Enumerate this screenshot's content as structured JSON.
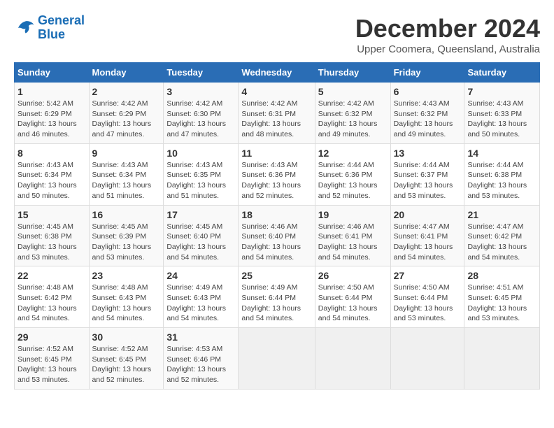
{
  "logo": {
    "line1": "General",
    "line2": "Blue"
  },
  "title": "December 2024",
  "location": "Upper Coomera, Queensland, Australia",
  "days_of_week": [
    "Sunday",
    "Monday",
    "Tuesday",
    "Wednesday",
    "Thursday",
    "Friday",
    "Saturday"
  ],
  "weeks": [
    [
      {
        "day": "1",
        "sunrise": "5:42 AM",
        "sunset": "6:29 PM",
        "daylight": "13 hours and 46 minutes."
      },
      {
        "day": "2",
        "sunrise": "4:42 AM",
        "sunset": "6:29 PM",
        "daylight": "13 hours and 47 minutes."
      },
      {
        "day": "3",
        "sunrise": "4:42 AM",
        "sunset": "6:30 PM",
        "daylight": "13 hours and 47 minutes."
      },
      {
        "day": "4",
        "sunrise": "4:42 AM",
        "sunset": "6:31 PM",
        "daylight": "13 hours and 48 minutes."
      },
      {
        "day": "5",
        "sunrise": "4:42 AM",
        "sunset": "6:32 PM",
        "daylight": "13 hours and 49 minutes."
      },
      {
        "day": "6",
        "sunrise": "4:43 AM",
        "sunset": "6:32 PM",
        "daylight": "13 hours and 49 minutes."
      },
      {
        "day": "7",
        "sunrise": "4:43 AM",
        "sunset": "6:33 PM",
        "daylight": "13 hours and 50 minutes."
      }
    ],
    [
      {
        "day": "8",
        "sunrise": "4:43 AM",
        "sunset": "6:34 PM",
        "daylight": "13 hours and 50 minutes."
      },
      {
        "day": "9",
        "sunrise": "4:43 AM",
        "sunset": "6:34 PM",
        "daylight": "13 hours and 51 minutes."
      },
      {
        "day": "10",
        "sunrise": "4:43 AM",
        "sunset": "6:35 PM",
        "daylight": "13 hours and 51 minutes."
      },
      {
        "day": "11",
        "sunrise": "4:43 AM",
        "sunset": "6:36 PM",
        "daylight": "13 hours and 52 minutes."
      },
      {
        "day": "12",
        "sunrise": "4:44 AM",
        "sunset": "6:36 PM",
        "daylight": "13 hours and 52 minutes."
      },
      {
        "day": "13",
        "sunrise": "4:44 AM",
        "sunset": "6:37 PM",
        "daylight": "13 hours and 53 minutes."
      },
      {
        "day": "14",
        "sunrise": "4:44 AM",
        "sunset": "6:38 PM",
        "daylight": "13 hours and 53 minutes."
      }
    ],
    [
      {
        "day": "15",
        "sunrise": "4:45 AM",
        "sunset": "6:38 PM",
        "daylight": "13 hours and 53 minutes."
      },
      {
        "day": "16",
        "sunrise": "4:45 AM",
        "sunset": "6:39 PM",
        "daylight": "13 hours and 53 minutes."
      },
      {
        "day": "17",
        "sunrise": "4:45 AM",
        "sunset": "6:40 PM",
        "daylight": "13 hours and 54 minutes."
      },
      {
        "day": "18",
        "sunrise": "4:46 AM",
        "sunset": "6:40 PM",
        "daylight": "13 hours and 54 minutes."
      },
      {
        "day": "19",
        "sunrise": "4:46 AM",
        "sunset": "6:41 PM",
        "daylight": "13 hours and 54 minutes."
      },
      {
        "day": "20",
        "sunrise": "4:47 AM",
        "sunset": "6:41 PM",
        "daylight": "13 hours and 54 minutes."
      },
      {
        "day": "21",
        "sunrise": "4:47 AM",
        "sunset": "6:42 PM",
        "daylight": "13 hours and 54 minutes."
      }
    ],
    [
      {
        "day": "22",
        "sunrise": "4:48 AM",
        "sunset": "6:42 PM",
        "daylight": "13 hours and 54 minutes."
      },
      {
        "day": "23",
        "sunrise": "4:48 AM",
        "sunset": "6:43 PM",
        "daylight": "13 hours and 54 minutes."
      },
      {
        "day": "24",
        "sunrise": "4:49 AM",
        "sunset": "6:43 PM",
        "daylight": "13 hours and 54 minutes."
      },
      {
        "day": "25",
        "sunrise": "4:49 AM",
        "sunset": "6:44 PM",
        "daylight": "13 hours and 54 minutes."
      },
      {
        "day": "26",
        "sunrise": "4:50 AM",
        "sunset": "6:44 PM",
        "daylight": "13 hours and 54 minutes."
      },
      {
        "day": "27",
        "sunrise": "4:50 AM",
        "sunset": "6:44 PM",
        "daylight": "13 hours and 53 minutes."
      },
      {
        "day": "28",
        "sunrise": "4:51 AM",
        "sunset": "6:45 PM",
        "daylight": "13 hours and 53 minutes."
      }
    ],
    [
      {
        "day": "29",
        "sunrise": "4:52 AM",
        "sunset": "6:45 PM",
        "daylight": "13 hours and 53 minutes."
      },
      {
        "day": "30",
        "sunrise": "4:52 AM",
        "sunset": "6:45 PM",
        "daylight": "13 hours and 52 minutes."
      },
      {
        "day": "31",
        "sunrise": "4:53 AM",
        "sunset": "6:46 PM",
        "daylight": "13 hours and 52 minutes."
      },
      null,
      null,
      null,
      null
    ]
  ]
}
